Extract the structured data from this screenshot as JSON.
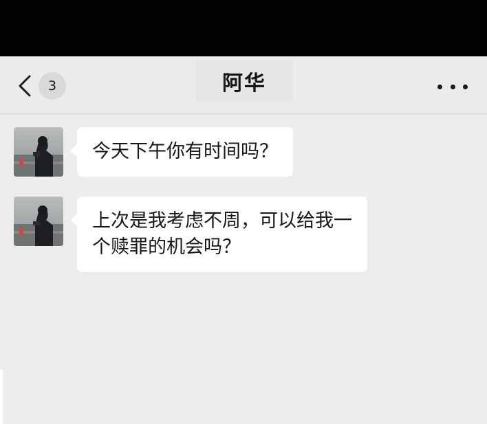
{
  "nav": {
    "unread_count": "3",
    "title": "阿华"
  },
  "messages": [
    {
      "text": "今天下午你有时间吗？"
    },
    {
      "text_line1": "上次是我考虑不周，可以给我一",
      "text_line2": "个赎罪的机会吗？"
    }
  ],
  "colors": {
    "background": "#ededed",
    "bubble": "#ffffff",
    "nav": "#ebebeb",
    "text": "#161616"
  }
}
